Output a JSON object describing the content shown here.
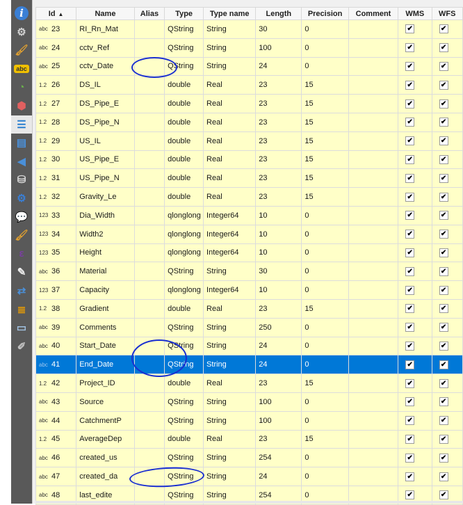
{
  "sidebar": {
    "items": [
      {
        "icon": "information-icon"
      },
      {
        "icon": "tools-icon"
      },
      {
        "icon": "style-brush-icon"
      },
      {
        "icon": "labels-abc-icon"
      },
      {
        "icon": "diagrams-icon"
      },
      {
        "icon": "3d-view-icon"
      },
      {
        "icon": "fields-icon",
        "active": true
      },
      {
        "icon": "attributes-form-icon"
      },
      {
        "icon": "joins-icon"
      },
      {
        "icon": "auxiliary-storage-icon"
      },
      {
        "icon": "actions-icon"
      },
      {
        "icon": "display-tooltip-icon"
      },
      {
        "icon": "rendering-icon"
      },
      {
        "icon": "variables-icon"
      },
      {
        "icon": "metadata-icon"
      },
      {
        "icon": "dependencies-icon"
      },
      {
        "icon": "legend-icon"
      },
      {
        "icon": "qgis-server-icon"
      },
      {
        "icon": "digitizing-icon"
      }
    ]
  },
  "table": {
    "headers": {
      "id": "Id",
      "name": "Name",
      "alias": "Alias",
      "type": "Type",
      "type_name": "Type name",
      "length": "Length",
      "precision": "Precision",
      "comment": "Comment",
      "wms": "WMS",
      "wfs": "WFS"
    },
    "sort_indicator": "▲",
    "rows": [
      {
        "code": "abc",
        "id": "23",
        "name": "RI_Rn_Mat",
        "alias": "",
        "type": "QString",
        "type_name": "String",
        "length": "30",
        "precision": "0",
        "comment": "",
        "wms": true,
        "wfs": true
      },
      {
        "code": "abc",
        "id": "24",
        "name": "cctv_Ref",
        "alias": "",
        "type": "QString",
        "type_name": "String",
        "length": "100",
        "precision": "0",
        "comment": "",
        "wms": true,
        "wfs": true
      },
      {
        "code": "abc",
        "id": "25",
        "name": "cctv_Date",
        "alias": "",
        "type": "QString",
        "type_name": "String",
        "length": "24",
        "precision": "0",
        "comment": "",
        "wms": true,
        "wfs": true
      },
      {
        "code": "1.2",
        "id": "26",
        "name": "DS_IL",
        "alias": "",
        "type": "double",
        "type_name": "Real",
        "length": "23",
        "precision": "15",
        "comment": "",
        "wms": true,
        "wfs": true
      },
      {
        "code": "1.2",
        "id": "27",
        "name": "DS_Pipe_E",
        "alias": "",
        "type": "double",
        "type_name": "Real",
        "length": "23",
        "precision": "15",
        "comment": "",
        "wms": true,
        "wfs": true
      },
      {
        "code": "1.2",
        "id": "28",
        "name": "DS_Pipe_N",
        "alias": "",
        "type": "double",
        "type_name": "Real",
        "length": "23",
        "precision": "15",
        "comment": "",
        "wms": true,
        "wfs": true
      },
      {
        "code": "1.2",
        "id": "29",
        "name": "US_IL",
        "alias": "",
        "type": "double",
        "type_name": "Real",
        "length": "23",
        "precision": "15",
        "comment": "",
        "wms": true,
        "wfs": true
      },
      {
        "code": "1.2",
        "id": "30",
        "name": "US_Pipe_E",
        "alias": "",
        "type": "double",
        "type_name": "Real",
        "length": "23",
        "precision": "15",
        "comment": "",
        "wms": true,
        "wfs": true
      },
      {
        "code": "1.2",
        "id": "31",
        "name": "US_Pipe_N",
        "alias": "",
        "type": "double",
        "type_name": "Real",
        "length": "23",
        "precision": "15",
        "comment": "",
        "wms": true,
        "wfs": true
      },
      {
        "code": "1.2",
        "id": "32",
        "name": "Gravity_Le",
        "alias": "",
        "type": "double",
        "type_name": "Real",
        "length": "23",
        "precision": "15",
        "comment": "",
        "wms": true,
        "wfs": true
      },
      {
        "code": "123",
        "id": "33",
        "name": "Dia_Width",
        "alias": "",
        "type": "qlonglong",
        "type_name": "Integer64",
        "length": "10",
        "precision": "0",
        "comment": "",
        "wms": true,
        "wfs": true
      },
      {
        "code": "123",
        "id": "34",
        "name": "Width2",
        "alias": "",
        "type": "qlonglong",
        "type_name": "Integer64",
        "length": "10",
        "precision": "0",
        "comment": "",
        "wms": true,
        "wfs": true
      },
      {
        "code": "123",
        "id": "35",
        "name": "Height",
        "alias": "",
        "type": "qlonglong",
        "type_name": "Integer64",
        "length": "10",
        "precision": "0",
        "comment": "",
        "wms": true,
        "wfs": true
      },
      {
        "code": "abc",
        "id": "36",
        "name": "Material",
        "alias": "",
        "type": "QString",
        "type_name": "String",
        "length": "30",
        "precision": "0",
        "comment": "",
        "wms": true,
        "wfs": true
      },
      {
        "code": "123",
        "id": "37",
        "name": "Capacity",
        "alias": "",
        "type": "qlonglong",
        "type_name": "Integer64",
        "length": "10",
        "precision": "0",
        "comment": "",
        "wms": true,
        "wfs": true
      },
      {
        "code": "1.2",
        "id": "38",
        "name": "Gradient",
        "alias": "",
        "type": "double",
        "type_name": "Real",
        "length": "23",
        "precision": "15",
        "comment": "",
        "wms": true,
        "wfs": true
      },
      {
        "code": "abc",
        "id": "39",
        "name": "Comments",
        "alias": "",
        "type": "QString",
        "type_name": "String",
        "length": "250",
        "precision": "0",
        "comment": "",
        "wms": true,
        "wfs": true
      },
      {
        "code": "abc",
        "id": "40",
        "name": "Start_Date",
        "alias": "",
        "type": "QString",
        "type_name": "String",
        "length": "24",
        "precision": "0",
        "comment": "",
        "wms": true,
        "wfs": true
      },
      {
        "code": "abc",
        "id": "41",
        "name": "End_Date",
        "alias": "",
        "type": "QString",
        "type_name": "String",
        "length": "24",
        "precision": "0",
        "comment": "",
        "wms": true,
        "wfs": true,
        "selected": true
      },
      {
        "code": "1.2",
        "id": "42",
        "name": "Project_ID",
        "alias": "",
        "type": "double",
        "type_name": "Real",
        "length": "23",
        "precision": "15",
        "comment": "",
        "wms": true,
        "wfs": true
      },
      {
        "code": "abc",
        "id": "43",
        "name": "Source",
        "alias": "",
        "type": "QString",
        "type_name": "String",
        "length": "100",
        "precision": "0",
        "comment": "",
        "wms": true,
        "wfs": true
      },
      {
        "code": "abc",
        "id": "44",
        "name": "CatchmentP",
        "alias": "",
        "type": "QString",
        "type_name": "String",
        "length": "100",
        "precision": "0",
        "comment": "",
        "wms": true,
        "wfs": true
      },
      {
        "code": "1.2",
        "id": "45",
        "name": "AverageDep",
        "alias": "",
        "type": "double",
        "type_name": "Real",
        "length": "23",
        "precision": "15",
        "comment": "",
        "wms": true,
        "wfs": true
      },
      {
        "code": "abc",
        "id": "46",
        "name": "created_us",
        "alias": "",
        "type": "QString",
        "type_name": "String",
        "length": "254",
        "precision": "0",
        "comment": "",
        "wms": true,
        "wfs": true
      },
      {
        "code": "abc",
        "id": "47",
        "name": "created_da",
        "alias": "",
        "type": "QString",
        "type_name": "String",
        "length": "24",
        "precision": "0",
        "comment": "",
        "wms": true,
        "wfs": true
      },
      {
        "code": "abc",
        "id": "48",
        "name": "last_edite",
        "alias": "",
        "type": "QString",
        "type_name": "String",
        "length": "254",
        "precision": "0",
        "comment": "",
        "wms": true,
        "wfs": true
      }
    ]
  },
  "annotations": {
    "circled_rows": [
      "25",
      "40-41",
      "47"
    ],
    "ink_color": "#1a2fd0"
  },
  "colors": {
    "row_background": "#ffffc8",
    "selection": "#0078d7"
  },
  "check_glyph": "✔"
}
